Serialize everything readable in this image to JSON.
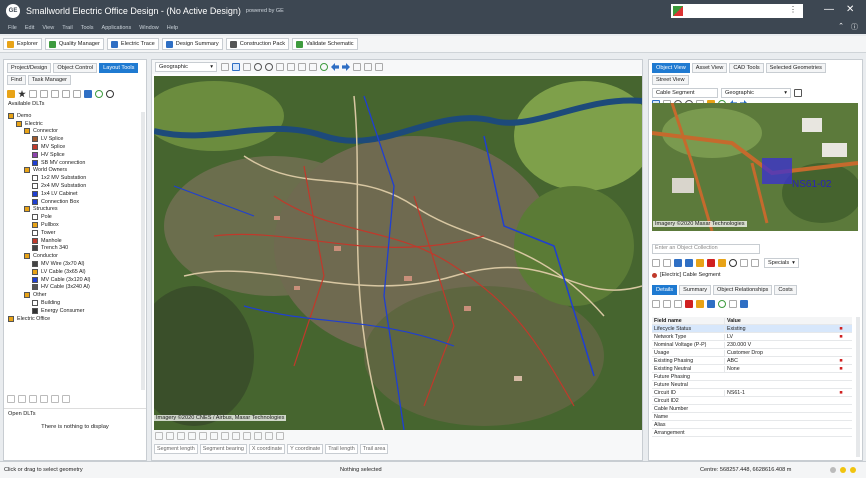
{
  "app": {
    "title": "Smallworld Electric Office Design - (No Active Design)",
    "powered": "powered by GE",
    "logo_text": "GE",
    "user_more": "⋮",
    "minimize": "—",
    "close": "✕"
  },
  "menu": {
    "items": [
      "File",
      "Edit",
      "View",
      "Trail",
      "Tools",
      "Applications",
      "Window",
      "Help"
    ],
    "collapse": "⌃",
    "help": "ⓘ"
  },
  "toolbar": {
    "buttons": [
      {
        "label": "Explorer",
        "color": "#e8a317"
      },
      {
        "label": "Quality Manager",
        "color": "#3e9b3e"
      },
      {
        "label": "Electric Trace",
        "color": "#2f6fc4"
      },
      {
        "label": "Design Summary",
        "color": "#2f6fc4"
      },
      {
        "label": "Construction Pack",
        "color": "#555555"
      },
      {
        "label": "Validate Schematic",
        "color": "#3e9b3e"
      }
    ]
  },
  "left": {
    "tabs": [
      "Project/Design",
      "Object Control",
      "Layout Tools",
      "Find",
      "Task Manager"
    ],
    "active_tab": "Layout Tools",
    "available_label": "Available DLTs",
    "open_label": "Open DLTs",
    "empty_message": "There is nothing to display",
    "tree": [
      {
        "label": "Demo",
        "level": 0,
        "icon": "folder"
      },
      {
        "label": "Electric",
        "level": 1,
        "icon": "folder"
      },
      {
        "label": "Connector",
        "level": 2,
        "icon": "folder"
      },
      {
        "label": "LV Splice",
        "level": 3,
        "icon": "splice-lv"
      },
      {
        "label": "MV Splice",
        "level": 3,
        "icon": "splice-mv"
      },
      {
        "label": "HV Splice",
        "level": 3,
        "icon": "splice-hv"
      },
      {
        "label": "SB MV connection",
        "level": 3,
        "icon": "sb-conn"
      },
      {
        "label": "World Owners",
        "level": 2,
        "icon": "folder"
      },
      {
        "label": "1x2 MV Substation",
        "level": 3,
        "icon": "substation"
      },
      {
        "label": "2x4 MV Substation",
        "level": 3,
        "icon": "substation"
      },
      {
        "label": "1x4 LV Cabinet",
        "level": 3,
        "icon": "cabinet"
      },
      {
        "label": "Connection Box",
        "level": 3,
        "icon": "box"
      },
      {
        "label": "Structures",
        "level": 2,
        "icon": "folder"
      },
      {
        "label": "Pole",
        "level": 3,
        "icon": "pole"
      },
      {
        "label": "Pullbox",
        "level": 3,
        "icon": "pullbox"
      },
      {
        "label": "Tower",
        "level": 3,
        "icon": "tower"
      },
      {
        "label": "Manhole",
        "level": 3,
        "icon": "manhole"
      },
      {
        "label": "Trench 340",
        "level": 3,
        "icon": "trench"
      },
      {
        "label": "Conductor",
        "level": 2,
        "icon": "folder"
      },
      {
        "label": "MV Wire (3x70 Al)",
        "level": 3,
        "icon": "wire"
      },
      {
        "label": "LV Cable (3x65 Al)",
        "level": 3,
        "icon": "lvcable"
      },
      {
        "label": "MV Cable (3x120 Al)",
        "level": 3,
        "icon": "mvcable"
      },
      {
        "label": "HV Cable (3x240 Al)",
        "level": 3,
        "icon": "hvcable"
      },
      {
        "label": "Other",
        "level": 2,
        "icon": "folder"
      },
      {
        "label": "Building",
        "level": 3,
        "icon": "building"
      },
      {
        "label": "Energy Consumer",
        "level": 3,
        "icon": "consumer"
      },
      {
        "label": "Electric Office",
        "level": 0,
        "icon": "folder"
      }
    ]
  },
  "map": {
    "view_select": "Geographic",
    "credit": "Imagery ©2020 CNES / Airbus, Maxar Technologies",
    "coord_fields": [
      "Segment length",
      "Segment bearing",
      "X coordinate",
      "Y coordinate",
      "Trail length",
      "Trail area"
    ]
  },
  "right": {
    "tabs": [
      "Object View",
      "Asset View",
      "CAD Tools",
      "Selected Geometries",
      "Street View"
    ],
    "active_tab": "Object View",
    "object_select": "Cable Segment",
    "view_select": "Geographic",
    "mini_credit": "Imagery ©2020 Maxar Technologies",
    "mini_label": "NS61-02",
    "collection_placeholder": "Enter an Object Collection",
    "specials": "Specials",
    "object_title": "[Electric] Cable Segment",
    "detail_tabs": [
      "Details",
      "Summary",
      "Object Relationships",
      "Costs"
    ],
    "grid_header": [
      "Field name",
      "Value"
    ],
    "grid_rows": [
      [
        "Lifecycle Status",
        "Existing"
      ],
      [
        "Network Type",
        "LV"
      ],
      [
        "Nominal Voltage (P-P)",
        "230.000 V"
      ],
      [
        "Usage",
        "Customer Drop"
      ],
      [
        "Existing Phasing",
        "ABC"
      ],
      [
        "Existing Neutral",
        "None"
      ],
      [
        "Future Phasing",
        ""
      ],
      [
        "Future Neutral",
        ""
      ],
      [
        "Circuit ID",
        "NS61-1"
      ],
      [
        "Circuit ID2",
        ""
      ],
      [
        "Cable Number",
        ""
      ],
      [
        "Name",
        ""
      ],
      [
        "Alias",
        ""
      ],
      [
        "Arrangement",
        ""
      ]
    ]
  },
  "status": {
    "left": "Click or drag to select geometry",
    "middle": "Nothing selected",
    "right": "Centre: 568257.448, 6628616.408 m"
  }
}
